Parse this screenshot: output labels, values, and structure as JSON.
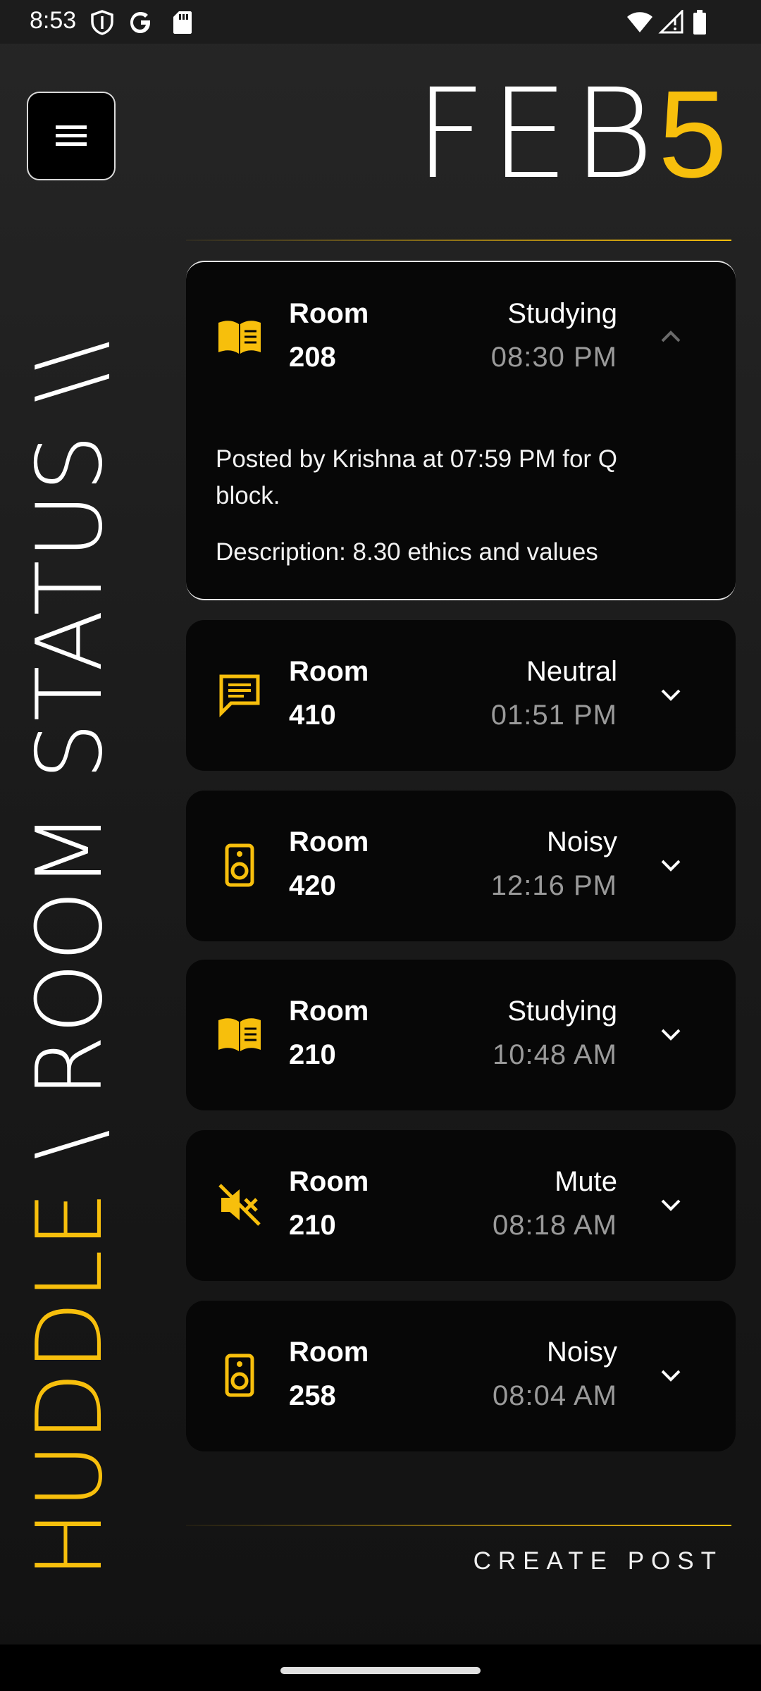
{
  "status_bar": {
    "time": "8:53"
  },
  "header": {
    "month": "FEB",
    "day": "5"
  },
  "title": {
    "part1": "HUDDLE",
    "part2": " \\ ROOM STATUS \\\\"
  },
  "cards": [
    {
      "icon": "book-icon",
      "room_label": "Room",
      "room_number": "208",
      "status": "Studying",
      "time": "08:30 PM",
      "expanded": true,
      "posted_by": "Posted by Krishna at 07:59 PM for Q block.",
      "description": "Description: 8.30 ethics and values"
    },
    {
      "icon": "chat-icon",
      "room_label": "Room",
      "room_number": "410",
      "status": "Neutral",
      "time": "01:51 PM"
    },
    {
      "icon": "speaker-icon",
      "room_label": "Room",
      "room_number": "420",
      "status": "Noisy",
      "time": "12:16 PM"
    },
    {
      "icon": "book-icon",
      "room_label": "Room",
      "room_number": "210",
      "status": "Studying",
      "time": "10:48 AM"
    },
    {
      "icon": "mute-icon",
      "room_label": "Room",
      "room_number": "210",
      "status": "Mute",
      "time": "08:18 AM"
    },
    {
      "icon": "speaker-icon",
      "room_label": "Room",
      "room_number": "258",
      "status": "Noisy",
      "time": "08:04 AM"
    }
  ],
  "footer": {
    "create_post": "CREATE POST"
  },
  "colors": {
    "accent": "#f7bf0c",
    "card": "#070707",
    "background": "#1e1e1e"
  }
}
